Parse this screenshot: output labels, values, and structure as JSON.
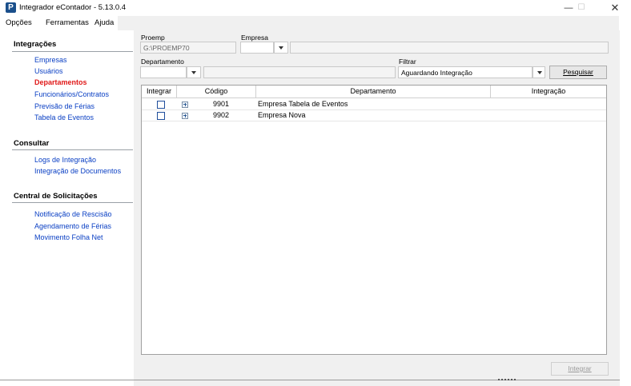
{
  "window": {
    "title": "Integrador eContador - 5.13.0.4",
    "app_icon_letter": "P",
    "minimize": "—",
    "maximize": "☐",
    "close": "✕"
  },
  "menu": [
    "Opções",
    "Ferramentas",
    "Ajuda"
  ],
  "sidebar": {
    "sections": [
      {
        "title": "Integrações",
        "items": [
          {
            "label": "Empresas",
            "active": false
          },
          {
            "label": "Usuários",
            "active": false
          },
          {
            "label": "Departamentos",
            "active": true
          },
          {
            "label": "Funcionários/Contratos",
            "active": false
          },
          {
            "label": "Previsão de Férias",
            "active": false
          },
          {
            "label": "Tabela de Eventos",
            "active": false
          }
        ]
      },
      {
        "title": "Consultar",
        "items": [
          {
            "label": "Logs de Integração",
            "active": false
          },
          {
            "label": "Integração de Documentos",
            "active": false
          }
        ]
      },
      {
        "title": "Central de Solicitações",
        "items": [
          {
            "label": "Notificação de Rescisão",
            "active": false
          },
          {
            "label": "Agendamento de Férias",
            "active": false
          },
          {
            "label": "Movimento Folha Net",
            "active": false
          }
        ]
      }
    ]
  },
  "filters": {
    "proemp_label": "Proemp",
    "proemp_value": "G:\\PROEMP70",
    "empresa_label": "Empresa",
    "empresa_value": "",
    "departamento_label": "Departamento",
    "departamento_value": "",
    "filtrar_label": "Filtrar",
    "filtrar_value": "Aguardando Integração",
    "pesquisar_label": "Pesquisar"
  },
  "grid": {
    "columns": [
      "Integrar",
      "Código",
      "Departamento",
      "Integração"
    ],
    "rows": [
      {
        "checked": false,
        "codigo": "9901",
        "departamento": "Empresa Tabela de Eventos",
        "integracao": ""
      },
      {
        "checked": false,
        "codigo": "9902",
        "departamento": "Empresa Nova",
        "integracao": ""
      }
    ]
  },
  "actions": {
    "integrar_label": "Integrar"
  }
}
